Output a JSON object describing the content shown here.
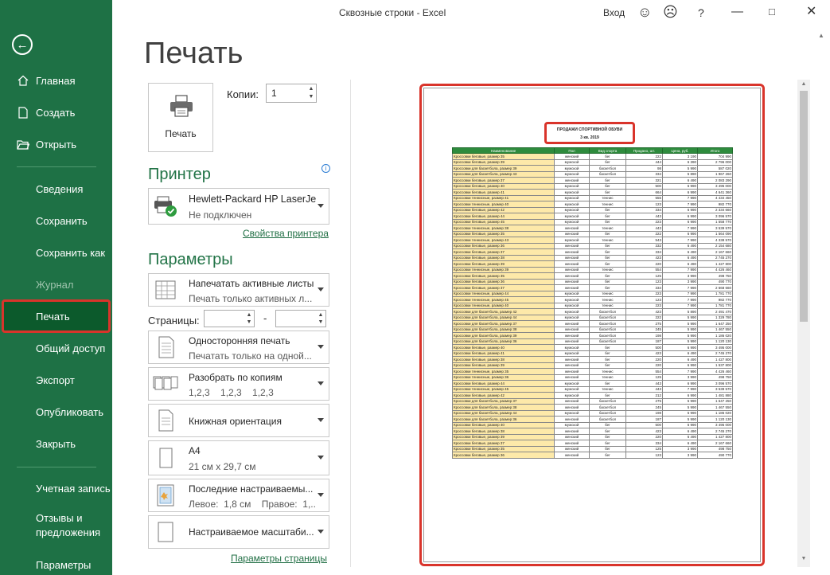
{
  "window": {
    "title": "Сквозные строки  -  Excel",
    "login": "Вход",
    "help": "?"
  },
  "page_title": "Печать",
  "sidebar": {
    "items": [
      {
        "label": "Главная"
      },
      {
        "label": "Создать"
      },
      {
        "label": "Открыть"
      },
      {
        "label": "Сведения"
      },
      {
        "label": "Сохранить"
      },
      {
        "label": "Сохранить как"
      },
      {
        "label": "Журнал"
      },
      {
        "label": "Печать"
      },
      {
        "label": "Общий доступ"
      },
      {
        "label": "Экспорт"
      },
      {
        "label": "Опубликовать"
      },
      {
        "label": "Закрыть"
      },
      {
        "label": "Учетная запись"
      },
      {
        "label": "Отзывы и предложения"
      },
      {
        "label": "Параметры"
      }
    ]
  },
  "print": {
    "button_label": "Печать",
    "copies_label": "Копии:",
    "copies_value": "1"
  },
  "printer": {
    "header": "Принтер",
    "name": "Hewlett-Packard HP LaserJe...",
    "status": "Не подключен",
    "properties_link": "Свойства принтера"
  },
  "settings": {
    "header": "Параметры",
    "what": {
      "l1": "Напечатать активные листы",
      "l2": "Печать только активных л..."
    },
    "pages_label": "Страницы:",
    "pages_dash": "-",
    "sides": {
      "l1": "Односторонняя печать",
      "l2": "Печатать только на одной..."
    },
    "collate": {
      "l1": "Разобрать по копиям",
      "l2": "1,2,3    1,2,3    1,2,3"
    },
    "orientation": {
      "l1": "Книжная ориентация"
    },
    "paper": {
      "l1": "A4",
      "l2": "21 см x 29,7 см"
    },
    "margins": {
      "l1": "Последние настраиваемы...",
      "l2": "Левое:  1,8 см    Правое:  1,..."
    },
    "scaling": {
      "l1": "Настраиваемое масштаби..."
    },
    "page_setup_link": "Параметры страницы"
  },
  "preview": {
    "heading1": "ПРОДАЖИ СПОРТИВНОЙ ОБУВИ",
    "heading2": "3 кв. 2019",
    "columns": [
      "Наименование",
      "Пол",
      "Вид спорта",
      "Продано, шт.",
      "Цена, руб.",
      "Итого"
    ],
    "rows": [
      [
        "Кроссовки беговые, размер 35",
        "женский",
        "бег",
        "222",
        "3 190",
        "704 990"
      ],
      [
        "Кроссовки беговые, размер 39",
        "мужской",
        "бег",
        "444",
        "6 390",
        "2 796 000"
      ],
      [
        "Кроссовки для баскетбола, размер 39",
        "мужской",
        "баскетбол",
        "98",
        "5 990",
        "587 020"
      ],
      [
        "Кроссовки для баскетбола, размер 43",
        "мужской",
        "баскетбол",
        "334",
        "5 890",
        "1 967 260"
      ],
      [
        "Кроссовки беговые, размер 37",
        "женский",
        "бег",
        "321",
        "6 490",
        "2 083 290"
      ],
      [
        "Кроссовки беговые, размер 40",
        "мужской",
        "бег",
        "500",
        "6 990",
        "3 495 000"
      ],
      [
        "Кроссовки беговые, размер 41",
        "мужской",
        "бег",
        "664",
        "6 990",
        "4 641 360"
      ],
      [
        "Кроссовки теннисные, размер 41",
        "мужской",
        "теннис",
        "555",
        "7 990",
        "4 434 450"
      ],
      [
        "Кроссовки теннисные, размер 40",
        "мужской",
        "теннис",
        "123",
        "7 990",
        "982 770"
      ],
      [
        "Кроссовки беговые, размер 42",
        "мужской",
        "бег",
        "334",
        "6 990",
        "2 334 660"
      ],
      [
        "Кроссовки беговые, размер 44",
        "мужской",
        "бег",
        "443",
        "6 990",
        "3 096 570"
      ],
      [
        "Кроссовки беговые, размер 45",
        "мужской",
        "бег",
        "223",
        "6 990",
        "1 558 770"
      ],
      [
        "Кроссовки теннисные, размер 38",
        "женский",
        "теннис",
        "443",
        "7 990",
        "3 539 570"
      ],
      [
        "Кроссовки беговые, размер 35",
        "женский",
        "бег",
        "222",
        "6 990",
        "1 564 090"
      ],
      [
        "Кроссовки теннисные, размер 43",
        "мужской",
        "теннис",
        "543",
        "7 990",
        "4 338 570"
      ],
      [
        "Кроссовки беговые, размер 36",
        "женский",
        "бег",
        "332",
        "6 490",
        "2 154 680"
      ],
      [
        "Кроссовки беговые, размер 37",
        "женский",
        "бег",
        "334",
        "6 490",
        "2 167 660"
      ],
      [
        "Кроссовки беговые, размер 38",
        "женский",
        "бег",
        "423",
        "6 490",
        "2 745 270"
      ],
      [
        "Кроссовки беговые, размер 39",
        "женский",
        "бег",
        "220",
        "6 490",
        "1 427 800"
      ],
      [
        "Кроссовки теннисные, размер 39",
        "женский",
        "теннис",
        "554",
        "7 990",
        "4 426 460"
      ],
      [
        "Кроссовки беговые, размер 35",
        "женский",
        "бег",
        "125",
        "3 990",
        "498 750"
      ],
      [
        "Кроссовки беговые, размер 36",
        "женский",
        "бег",
        "123",
        "3 990",
        "490 770"
      ],
      [
        "Кроссовки беговые, размер 37",
        "женский",
        "бег",
        "334",
        "7 990",
        "2 668 660"
      ],
      [
        "Кроссовки теннисные, размер 44",
        "мужской",
        "теннис",
        "223",
        "7 990",
        "1 781 770"
      ],
      [
        "Кроссовки теннисные, размер 45",
        "мужской",
        "теннис",
        "123",
        "7 990",
        "982 770"
      ],
      [
        "Кроссовки теннисные, размер 40",
        "мужской",
        "теннис",
        "223",
        "7 990",
        "1 781 770"
      ],
      [
        "Кроссовки для баскетбола, размер 42",
        "мужской",
        "баскетбол",
        "423",
        "5 890",
        "2 491 470"
      ],
      [
        "Кроссовки для баскетбола, размер 44",
        "мужской",
        "баскетбол",
        "222",
        "5 990",
        "1 329 780"
      ],
      [
        "Кроссовки для баскетбола, размер 37",
        "женский",
        "баскетбол",
        "275",
        "5 990",
        "1 647 250"
      ],
      [
        "Кроссовки для баскетбола, размер 38",
        "женский",
        "баскетбол",
        "245",
        "5 990",
        "1 467 550"
      ],
      [
        "Кроссовки для баскетбола, размер 39",
        "женский",
        "баскетбол",
        "198",
        "5 990",
        "1 186 020"
      ],
      [
        "Кроссовки для баскетбола, размер 36",
        "женский",
        "баскетбол",
        "187",
        "5 990",
        "1 120 130"
      ],
      [
        "Кроссовки беговые, размер 40",
        "мужской",
        "бег",
        "500",
        "6 990",
        "3 495 000"
      ],
      [
        "Кроссовки беговые, размер 41",
        "мужской",
        "бег",
        "423",
        "6 490",
        "2 745 270"
      ],
      [
        "Кроссовки беговые, размер 38",
        "женский",
        "бег",
        "220",
        "6 490",
        "1 427 800"
      ],
      [
        "Кроссовки беговые, размер 39",
        "женский",
        "бег",
        "220",
        "6 990",
        "1 537 800"
      ],
      [
        "Кроссовки теннисные, размер 35",
        "женский",
        "теннис",
        "554",
        "7 990",
        "4 426 460"
      ],
      [
        "Кроссовки теннисные, размер 36",
        "женский",
        "теннис",
        "125",
        "3 990",
        "498 750"
      ],
      [
        "Кроссовки беговые, размер 44",
        "мужской",
        "бег",
        "443",
        "6 990",
        "3 096 570"
      ],
      [
        "Кроссовки теннисные, размер 45",
        "мужской",
        "теннис",
        "443",
        "7 990",
        "3 539 570"
      ],
      [
        "Кроссовки беговые, размер 42",
        "мужской",
        "бег",
        "212",
        "6 990",
        "1 481 880"
      ],
      [
        "Кроссовки для баскетбола, размер 37",
        "женский",
        "баскетбол",
        "275",
        "5 990",
        "1 647 250"
      ],
      [
        "Кроссовки для баскетбола, размер 38",
        "женский",
        "баскетбол",
        "245",
        "5 990",
        "1 467 550"
      ],
      [
        "Кроссовки для баскетбола, размер 44",
        "мужской",
        "баскетбол",
        "198",
        "5 990",
        "1 186 020"
      ],
      [
        "Кроссовки для баскетбола, размер 36",
        "женский",
        "баскетбол",
        "187",
        "5 990",
        "1 120 130"
      ],
      [
        "Кроссовки беговые, размер 40",
        "мужской",
        "бег",
        "500",
        "6 990",
        "3 495 000"
      ],
      [
        "Кроссовки беговые, размер 38",
        "женский",
        "бег",
        "423",
        "6 490",
        "2 745 270"
      ],
      [
        "Кроссовки беговые, размер 39",
        "женский",
        "бег",
        "220",
        "6 490",
        "1 427 800"
      ],
      [
        "Кроссовки беговые, размер 37",
        "женский",
        "бег",
        "334",
        "6 490",
        "2 167 660"
      ],
      [
        "Кроссовки беговые, размер 35",
        "женский",
        "бег",
        "125",
        "3 990",
        "498 750"
      ],
      [
        "Кроссовки беговые, размер 36",
        "женский",
        "бег",
        "123",
        "3 990",
        "490 770"
      ]
    ]
  },
  "colors": {
    "sidebar": "#1e7145",
    "accent": "#217346",
    "highlight": "#d9342b",
    "table_header": "#2e8b3d",
    "name_cell": "#fde9a9"
  }
}
